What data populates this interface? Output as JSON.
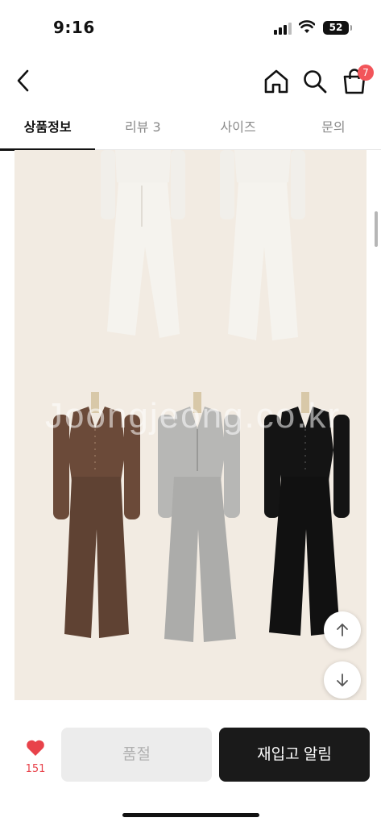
{
  "status_bar": {
    "time": "9:16",
    "battery": "52"
  },
  "header": {
    "back_icon": "chevron-left-icon",
    "home_icon": "home-icon",
    "search_icon": "search-icon",
    "cart_icon": "shopping-bag-icon",
    "cart_count": "7"
  },
  "tabs": [
    {
      "label": "상품정보",
      "active": true
    },
    {
      "label": "리뷰 3",
      "active": false
    },
    {
      "label": "사이즈",
      "active": false
    },
    {
      "label": "문의",
      "active": false
    }
  ],
  "product_image": {
    "watermark": "Joongjeong.co.kr",
    "background_color": "#f2ebe2",
    "outfit_colors": [
      "#6b4a39",
      "#b7b7b5",
      "#141414"
    ]
  },
  "floating": {
    "scroll_up_icon": "arrow-up-icon",
    "scroll_down_icon": "arrow-down-icon"
  },
  "bottom_bar": {
    "like_icon": "heart-icon",
    "like_count": "151",
    "soldout_label": "품절",
    "restock_label": "재입고 알림",
    "accent_color": "#e8424a"
  }
}
